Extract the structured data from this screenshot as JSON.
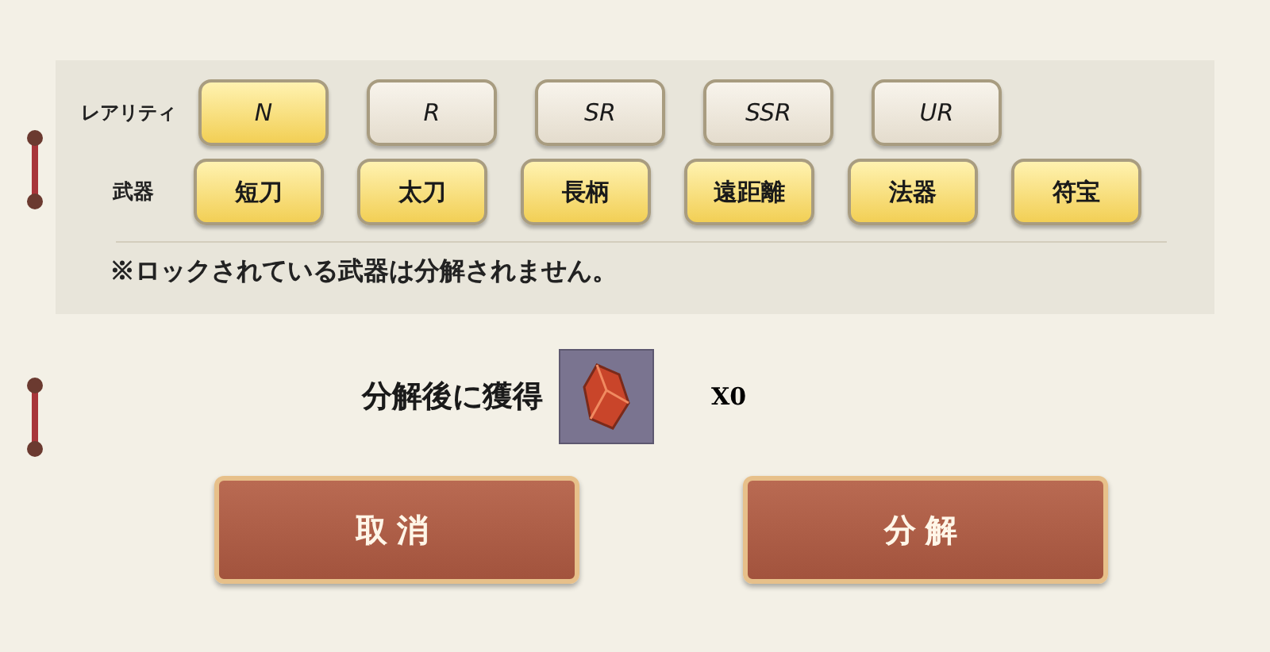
{
  "filters": [
    {
      "label": "レアリティ",
      "kind": "rarity",
      "options": [
        {
          "label": "N",
          "selected": true
        },
        {
          "label": "R",
          "selected": false
        },
        {
          "label": "SR",
          "selected": false
        },
        {
          "label": "SSR",
          "selected": false
        },
        {
          "label": "UR",
          "selected": false
        }
      ]
    },
    {
      "label": "武器",
      "kind": "weapon",
      "options": [
        {
          "label": "短刀",
          "selected": true
        },
        {
          "label": "太刀",
          "selected": true
        },
        {
          "label": "長柄",
          "selected": true
        },
        {
          "label": "遠距離",
          "selected": true
        },
        {
          "label": "法器",
          "selected": true
        },
        {
          "label": "符宝",
          "selected": true
        }
      ]
    }
  ],
  "note": "※ロックされている武器は分解されません。",
  "reward": {
    "label": "分解後に獲得",
    "count": "X0"
  },
  "buttons": [
    "取消",
    "分解"
  ]
}
